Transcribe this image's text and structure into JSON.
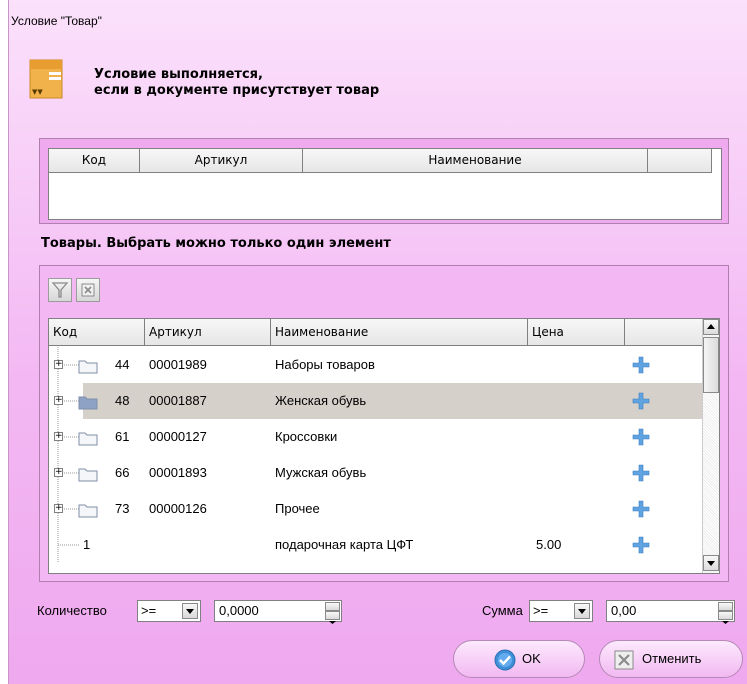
{
  "window": {
    "title": "Условие \"Товар\""
  },
  "header": {
    "line1": "Условие выполняется,",
    "line2": "если в документе присутствует товар"
  },
  "selected_table": {
    "columns": [
      "Код",
      "Артикул",
      "Наименование",
      ""
    ]
  },
  "goods": {
    "label": "Товары. Выбрать можно только один элемент",
    "toolbar": {
      "filter_icon": "filter-icon",
      "clear_icon": "clear-filter-icon"
    },
    "columns": [
      "Код",
      "Артикул",
      "Наименование",
      "Цена",
      ""
    ],
    "rows": [
      {
        "code": "44",
        "article": "00001989",
        "name": "Наборы товаров",
        "price": "",
        "folder": true
      },
      {
        "code": "48",
        "article": "00001887",
        "name": "Женская обувь",
        "price": "",
        "folder": true,
        "selected": true
      },
      {
        "code": "61",
        "article": "00000127",
        "name": "Кроссовки",
        "price": "",
        "folder": true
      },
      {
        "code": "66",
        "article": "00001893",
        "name": "Мужская обувь",
        "price": "",
        "folder": true
      },
      {
        "code": "73",
        "article": "00000126",
        "name": "Прочее",
        "price": "",
        "folder": true
      },
      {
        "code": "1",
        "article": "",
        "name": "подарочная карта ЦФТ",
        "price": "5.00",
        "folder": false
      }
    ],
    "expand_glyph": "+",
    "add_icon": "add-plus-icon"
  },
  "quantity": {
    "label": "Количество",
    "operator": ">=",
    "value": "0,0000"
  },
  "sum": {
    "label": "Сумма",
    "operator": ">=",
    "value": "0,00"
  },
  "buttons": {
    "ok": "OK",
    "cancel": "Отменить"
  },
  "colors": {
    "background": "#f3b8f3",
    "selection": "#d6d0ca",
    "plus": "#5fa3e0"
  }
}
